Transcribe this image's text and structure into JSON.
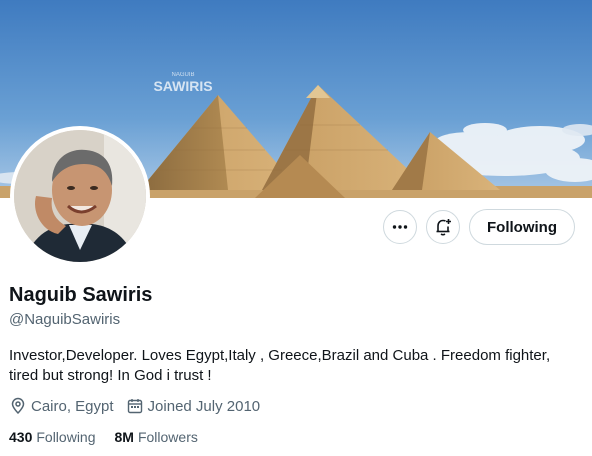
{
  "banner": {
    "watermark_top": "NAGUIB",
    "watermark_main": "SAWIRIS"
  },
  "profile": {
    "name": "Naguib Sawiris",
    "handle": "@NaguibSawiris",
    "bio": "Investor,Developer. Loves Egypt,Italy , Greece,Brazil and Cuba . Freedom fighter, tired but strong! In God i trust !",
    "location": "Cairo, Egypt",
    "joined": "Joined July 2010"
  },
  "actions": {
    "more_icon": "more-icon",
    "notify_icon": "bell-plus-icon",
    "follow_label": "Following"
  },
  "stats": {
    "following_count": "430",
    "following_label": "Following",
    "followers_count": "8M",
    "followers_label": "Followers"
  },
  "colors": {
    "text": "#0f1419",
    "secondary_text": "#536471",
    "border": "#cfd9de",
    "sky": "#5b8fc7"
  }
}
